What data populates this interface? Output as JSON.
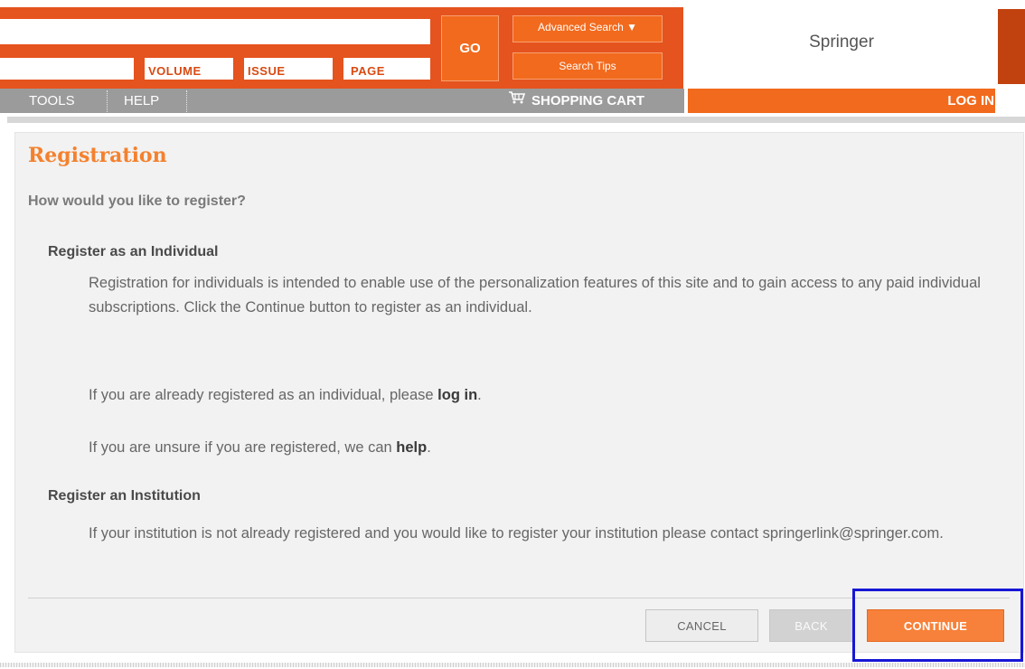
{
  "header": {
    "go_label": "GO",
    "advanced_search_label": "Advanced Search ▼",
    "search_tips_label": "Search Tips",
    "volume_label": "VOLUME",
    "issue_label": "ISSUE",
    "page_label": "PAGE",
    "brand": "Springer",
    "brand_color": "#e5531e"
  },
  "nav": {
    "tools_label": "TOOLS",
    "help_label": "HELP",
    "cart_label": "SHOPPING CART",
    "login_label": "LOG IN"
  },
  "main": {
    "title": "Registration",
    "question": "How would you like to register?",
    "individual": {
      "heading": "Register as an Individual",
      "desc": "Registration for individuals is intended to enable use of the personalization features of this site and to gain access to any paid individual subscriptions. Click the Continue button to register as an individual.",
      "already_prefix": "If you are already registered as an individual, please ",
      "already_link": "log in",
      "already_suffix": ".",
      "unsure_prefix": "If you are unsure if you are registered, we can ",
      "unsure_link": "help",
      "unsure_suffix": "."
    },
    "institution": {
      "heading": "Register an Institution",
      "desc": "If your institution is not already registered and you would like to register your institution please contact springerlink@springer.com."
    }
  },
  "footer": {
    "cancel_label": "CANCEL",
    "back_label": "BACK",
    "continue_label": "CONTINUE",
    "accent_color": "#f7813a",
    "highlight_color": "#1717d6"
  }
}
